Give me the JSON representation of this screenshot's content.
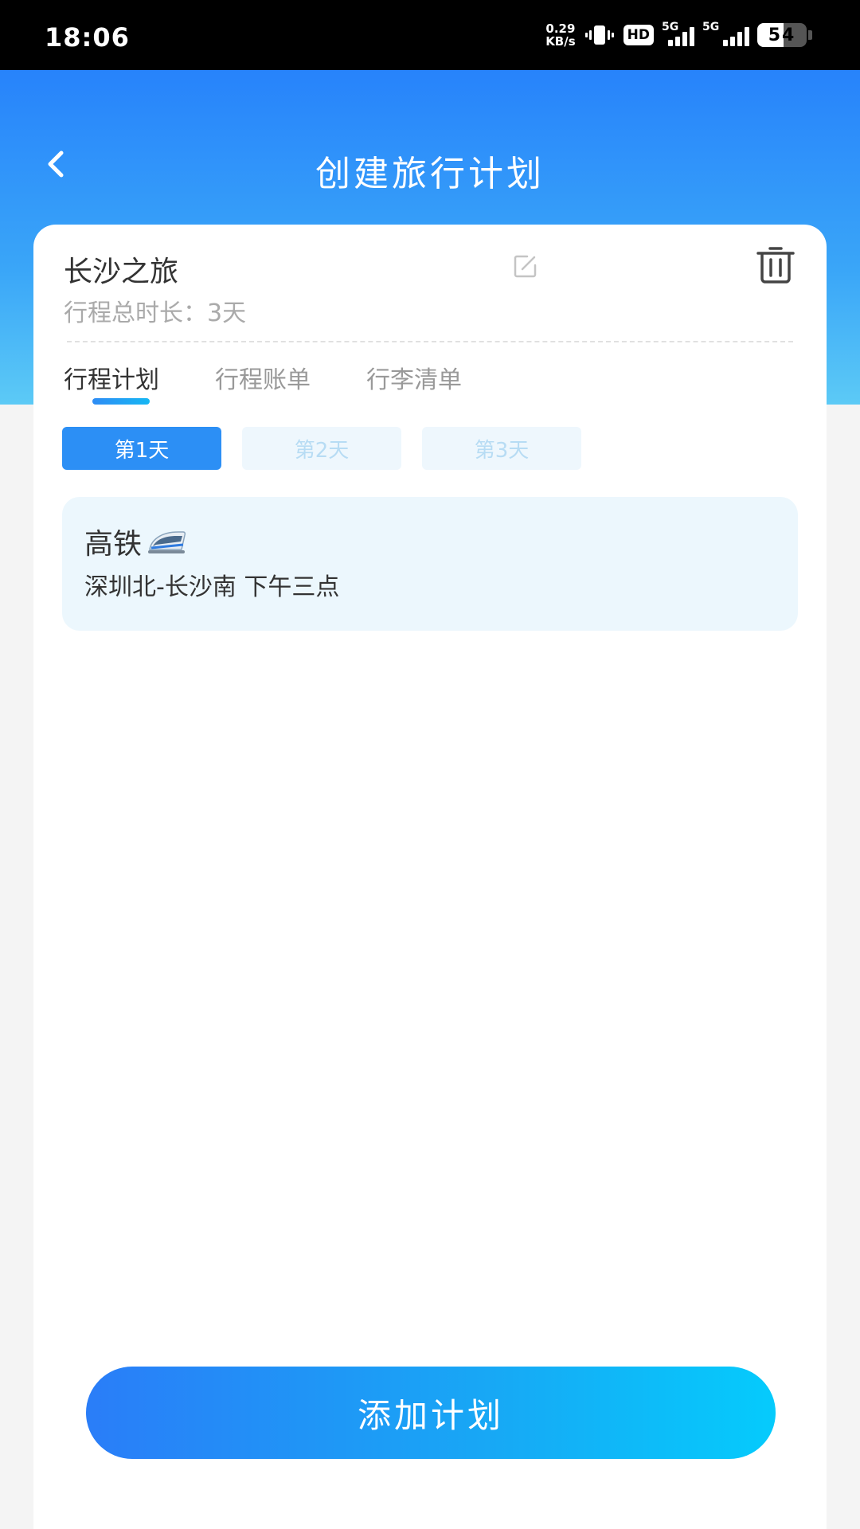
{
  "status_bar": {
    "time": "18:06",
    "net_speed_value": "0.29",
    "net_speed_unit": "KB/s",
    "hd_label": "HD",
    "signal_1_label": "5G",
    "signal_2_label": "5G",
    "battery_level": "54",
    "battery_fraction": 0.54
  },
  "header": {
    "title": "创建旅行计划",
    "back_icon": "chevron-left-icon"
  },
  "trip": {
    "name": "长沙之旅",
    "duration_label": "行程总时长：3天",
    "edit_icon": "edit-icon",
    "delete_icon": "trash-icon"
  },
  "tabs": [
    {
      "label": "行程计划",
      "active": true
    },
    {
      "label": "行程账单",
      "active": false
    },
    {
      "label": "行李清单",
      "active": false
    }
  ],
  "days": [
    {
      "label": "第1天",
      "active": true
    },
    {
      "label": "第2天",
      "active": false
    },
    {
      "label": "第3天",
      "active": false
    }
  ],
  "plan_items": [
    {
      "title": "高铁",
      "icon": "high-speed-train-icon",
      "desc": "深圳北-长沙南 下午三点"
    }
  ],
  "actions": {
    "add_label": "添加计划"
  },
  "colors": {
    "accent": "#2c8ff5",
    "header_top": "#2783fb",
    "header_bottom": "#5ccaf6",
    "plan_bg": "#ecf7fd"
  }
}
